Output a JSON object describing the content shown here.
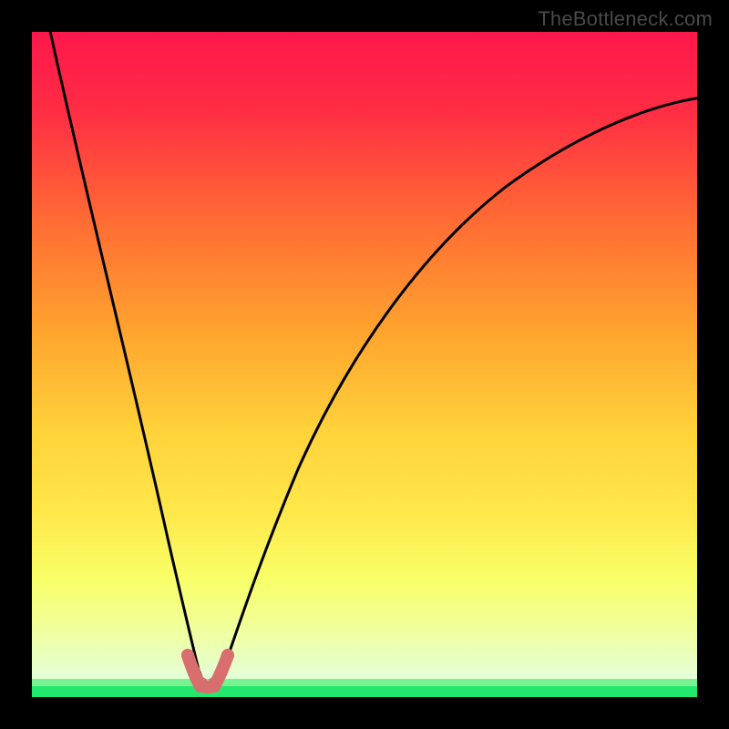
{
  "watermark": "TheBottleneck.com",
  "colors": {
    "frame": "#000000",
    "curve": "#000000",
    "salmon": "#d96e6e",
    "green": "#23e86e",
    "gradient": [
      "#ff174c",
      "#ff4a3a",
      "#ff8e2e",
      "#ffd23a",
      "#ffe74a",
      "#f6ff6e",
      "#f0ffaa",
      "#e8ffc7"
    ]
  },
  "chart_data": {
    "type": "line",
    "title": "",
    "xlabel": "",
    "ylabel": "",
    "xlim": [
      0,
      100
    ],
    "ylim": [
      0,
      100
    ],
    "x": [
      0,
      2,
      4,
      6,
      8,
      10,
      12,
      14,
      16,
      18,
      20,
      22,
      23,
      24,
      25,
      26,
      27,
      28,
      30,
      32,
      36,
      40,
      46,
      54,
      62,
      70,
      78,
      86,
      94,
      100
    ],
    "values": [
      105,
      96,
      87,
      78,
      70,
      62,
      54,
      46,
      38,
      30,
      22,
      14,
      8,
      3,
      0,
      0,
      3,
      8,
      15,
      21,
      31,
      39,
      49,
      58,
      65,
      71,
      76,
      80,
      84,
      86
    ],
    "minimum_x": 25,
    "salmon_segment_x": [
      22.5,
      28.5
    ],
    "green_band_y": [
      0,
      5
    ]
  }
}
